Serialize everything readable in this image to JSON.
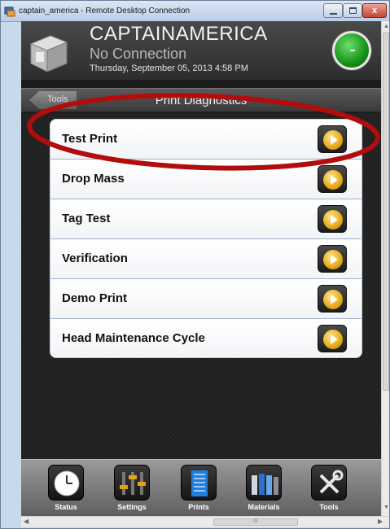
{
  "window": {
    "title": "captain_america - Remote Desktop Connection",
    "close_glyph": "x"
  },
  "header": {
    "printer_name": "CAPTAINAMERICA",
    "connection_status": "No Connection",
    "datetime": "Thursday, September 05, 2013 4:58 PM",
    "status_light_color": "#179117"
  },
  "subheader": {
    "back_label": "Tools",
    "title": "Print Diagnostics"
  },
  "diagnostics": [
    {
      "label": "Test Print"
    },
    {
      "label": "Drop Mass"
    },
    {
      "label": "Tag Test"
    },
    {
      "label": "Verification"
    },
    {
      "label": "Demo Print"
    },
    {
      "label": "Head Maintenance Cycle"
    }
  ],
  "bottom_nav": [
    {
      "label": "Status",
      "icon": "clock-icon"
    },
    {
      "label": "Settings",
      "icon": "sliders-icon"
    },
    {
      "label": "Prints",
      "icon": "document-stack-icon"
    },
    {
      "label": "Materials",
      "icon": "cartridges-icon"
    },
    {
      "label": "Tools",
      "icon": "tools-icon"
    }
  ],
  "colors": {
    "highlight": "#b20c0c",
    "accent_gold": "#e2a410"
  },
  "scrollbar": {
    "grip": "III"
  }
}
